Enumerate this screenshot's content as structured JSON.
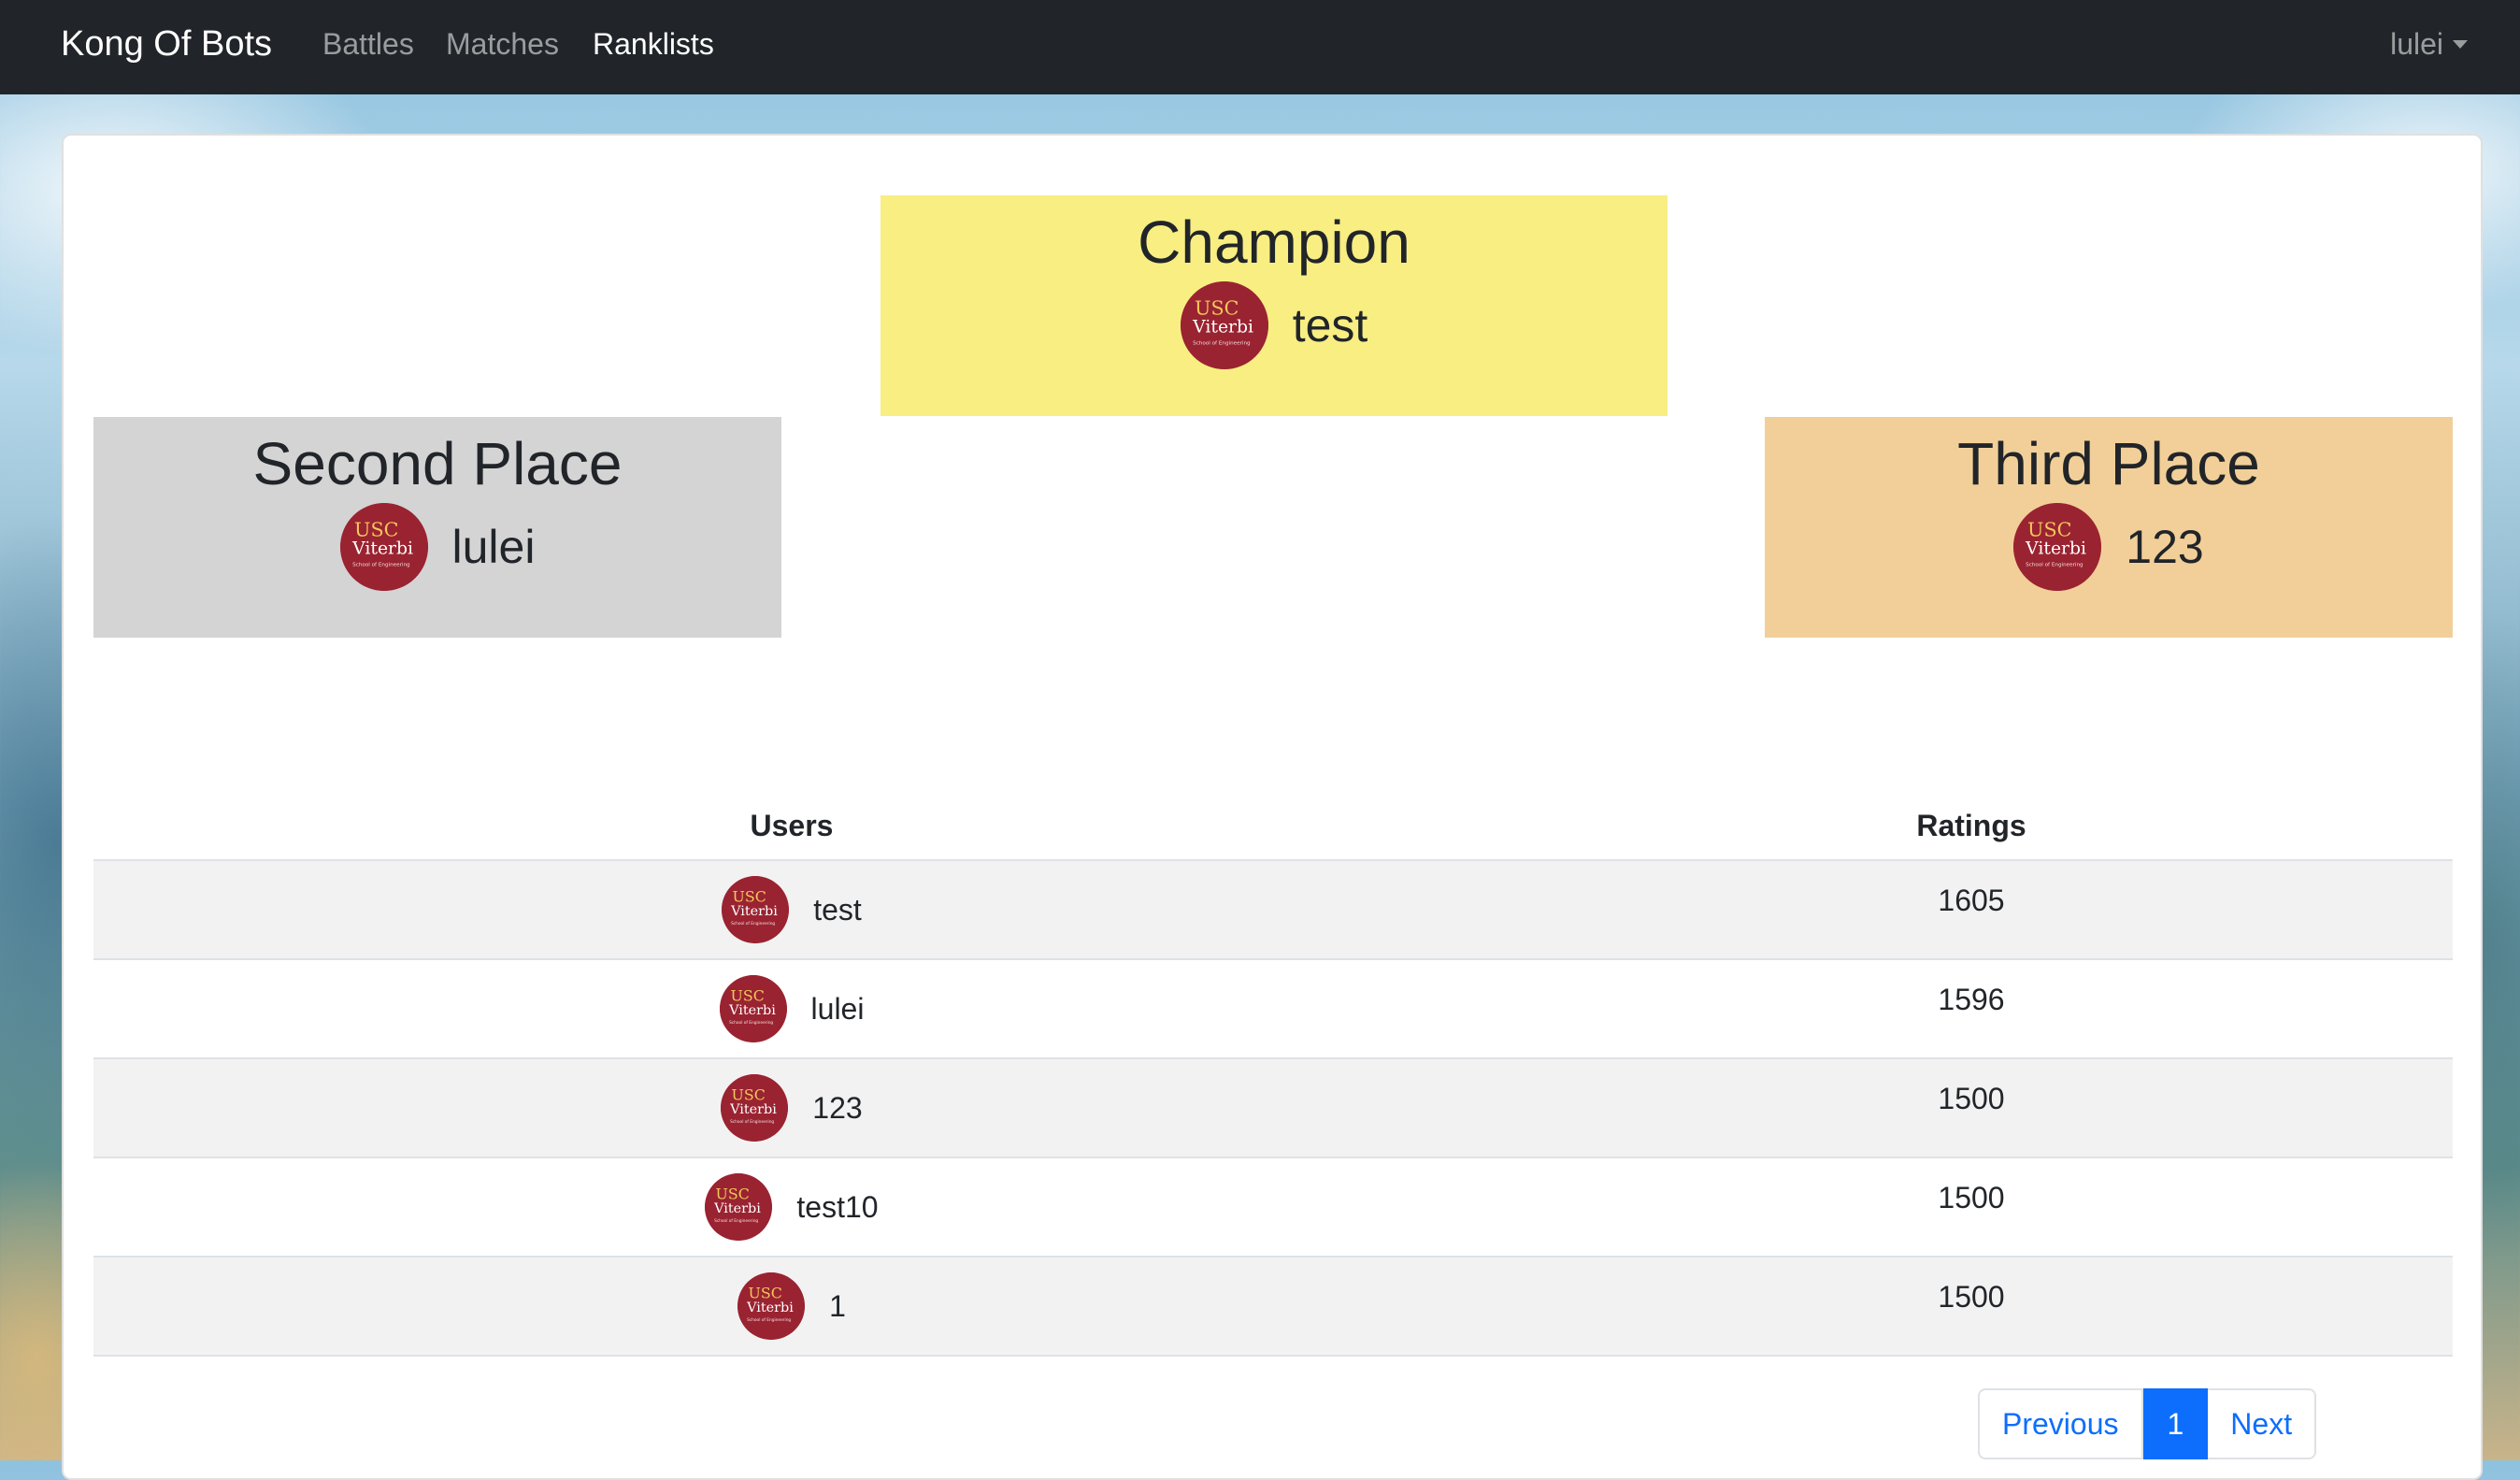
{
  "nav": {
    "brand": "Kong Of Bots",
    "links": [
      "Battles",
      "Matches",
      "Ranklists"
    ],
    "active": "Ranklists",
    "user": "lulei"
  },
  "podium": {
    "champion": {
      "title": "Champion",
      "name": "test"
    },
    "second": {
      "title": "Second Place",
      "name": "lulei"
    },
    "third": {
      "title": "Third Place",
      "name": "123"
    }
  },
  "avatar": {
    "line1": "USC",
    "line2": "Viterbi",
    "line3": "School of Engineering",
    "bg_color": "#9a2331",
    "accent_color": "#f2c75c"
  },
  "table": {
    "headers": {
      "users": "Users",
      "ratings": "Ratings"
    },
    "rows": [
      {
        "user": "test",
        "rating": "1605"
      },
      {
        "user": "lulei",
        "rating": "1596"
      },
      {
        "user": "123",
        "rating": "1500"
      },
      {
        "user": "test10",
        "rating": "1500"
      },
      {
        "user": "1",
        "rating": "1500"
      }
    ]
  },
  "pagination": {
    "previous": "Previous",
    "current": "1",
    "next": "Next"
  },
  "colors": {
    "navbar": "#212529",
    "champion": "#f8ee82",
    "second": "#d4d4d4",
    "third": "#f2cf99",
    "primary": "#0d6efd"
  }
}
